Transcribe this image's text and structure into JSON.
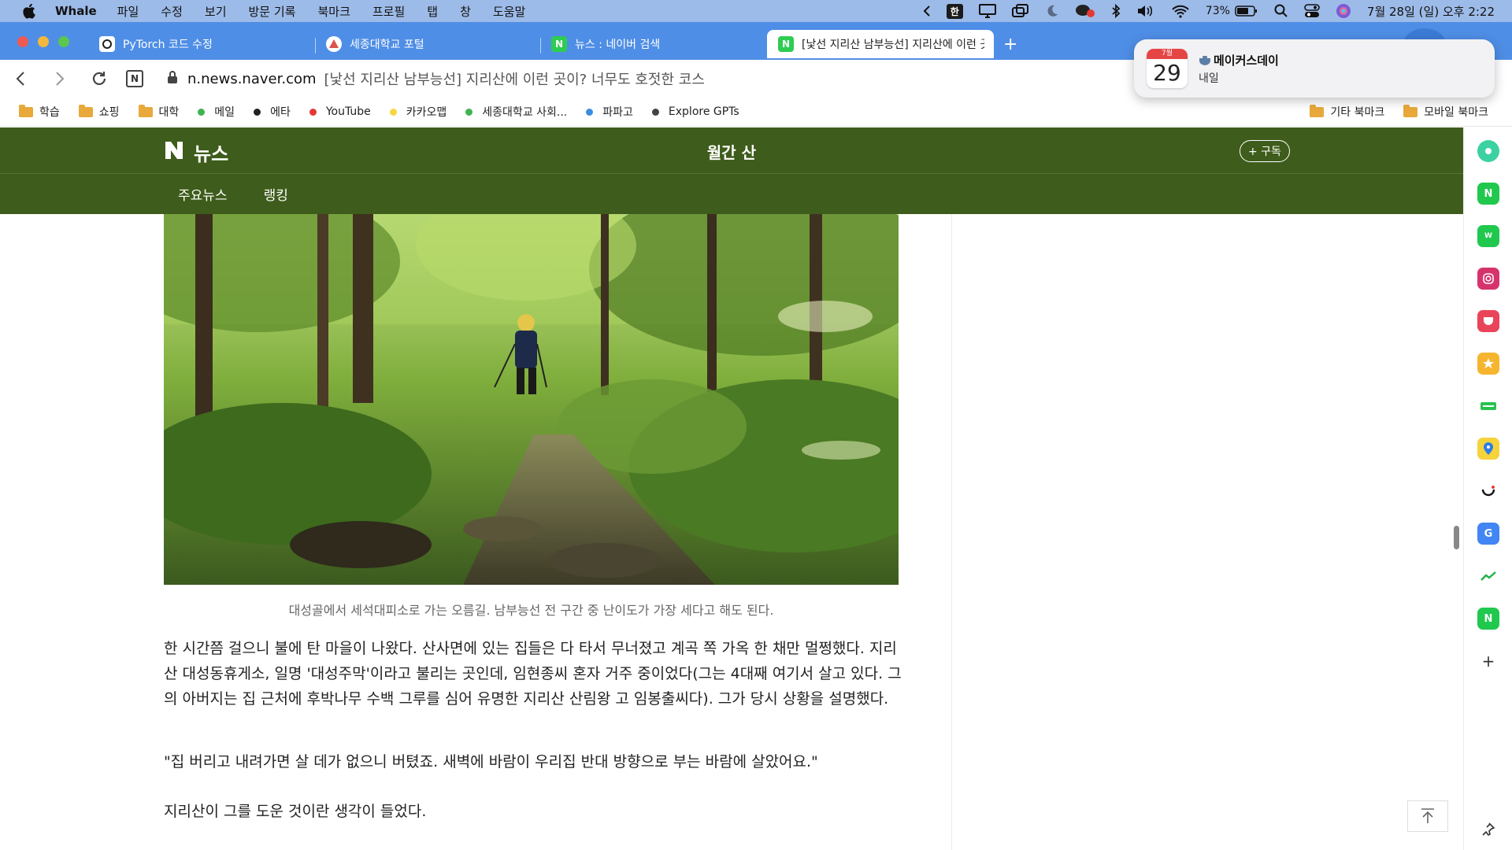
{
  "menubar": {
    "app_name": "Whale",
    "items": [
      "파일",
      "수정",
      "보기",
      "방문 기록",
      "북마크",
      "프로필",
      "탭",
      "창",
      "도움말"
    ],
    "ime": "한",
    "battery": "73%",
    "clock": "7월 28일 (일) 오후 2:22"
  },
  "tabs": [
    {
      "title": "PyTorch 코드 수정",
      "icon": "chatgpt-icon"
    },
    {
      "title": "세종대학교 포털",
      "icon": "sejong-icon"
    },
    {
      "title": "뉴스 : 네이버 검색",
      "icon": "naver-icon"
    },
    {
      "title": "[낯선 지리산 남부능선] 지리산에 이런 곳이? 너무도 호젓한 코스",
      "icon": "naver-icon",
      "active": true
    }
  ],
  "address": {
    "host": "n.news.naver.com",
    "title": "[낯선 지리산 남부능선] 지리산에 이런 곳이? 너무도 호젓한 코스"
  },
  "bookmarks": {
    "left": [
      {
        "label": "학습",
        "type": "folder"
      },
      {
        "label": "쇼핑",
        "type": "folder"
      },
      {
        "label": "대학",
        "type": "folder"
      },
      {
        "label": "메일",
        "type": "dot",
        "color": "#3fb34f"
      },
      {
        "label": "에타",
        "type": "dot",
        "color": "#222222"
      },
      {
        "label": "YouTube",
        "type": "dot",
        "color": "#e53935"
      },
      {
        "label": "카카오맵",
        "type": "dot",
        "color": "#f5d742"
      },
      {
        "label": "세종대학교 사회...",
        "type": "dot",
        "color": "#3fb34f"
      },
      {
        "label": "파파고",
        "type": "dot",
        "color": "#3b8de0"
      },
      {
        "label": "Explore GPTs",
        "type": "dot",
        "color": "#444444"
      }
    ],
    "right": [
      {
        "label": "기타 북마크",
        "type": "folder"
      },
      {
        "label": "모바일 북마크",
        "type": "folder"
      }
    ]
  },
  "notification": {
    "cal_month": "7월",
    "cal_day": "29",
    "title": "메이커스데이",
    "subtitle": "내일"
  },
  "site": {
    "logo_text": "뉴스",
    "section_title": "월간 산",
    "subscribe_label": "+ 구독",
    "subnav": [
      "주요뉴스",
      "랭킹"
    ]
  },
  "article": {
    "caption": "대성골에서 세석대피소로 가는 오름길. 남부능선 전 구간 중 난이도가 가장 세다고 해도 된다.",
    "paragraphs": [
      "한 시간쯤 걸으니 불에 탄 마을이 나왔다. 산사면에 있는 집들은 다 타서 무너졌고 계곡 쪽 가옥 한 채만 멀쩡했다. 지리산 대성동휴게소, 일명 '대성주막'이라고 불리는 곳인데, 임현종씨 혼자 거주 중이었다(그는 4대째 여기서 살고 있다. 그의 아버지는 집 근처에 후박나무 수백 그루를 심어 유명한 지리산 산림왕 고 임봉출씨다). 그가 당시 상황을 설명했다.",
      "\"집 버리고 내려가면 살 데가 없으니 버텼죠. 새벽에 바람이 우리집 반대 방향으로 부는 바람에 살았어요.\"",
      "지리산이 그를 도운 것이란 생각이 들었다."
    ]
  },
  "colors": {
    "menubar": "#9dbbe8",
    "tabstrip": "#4f8ee6",
    "site_header": "#3e5c1b"
  }
}
